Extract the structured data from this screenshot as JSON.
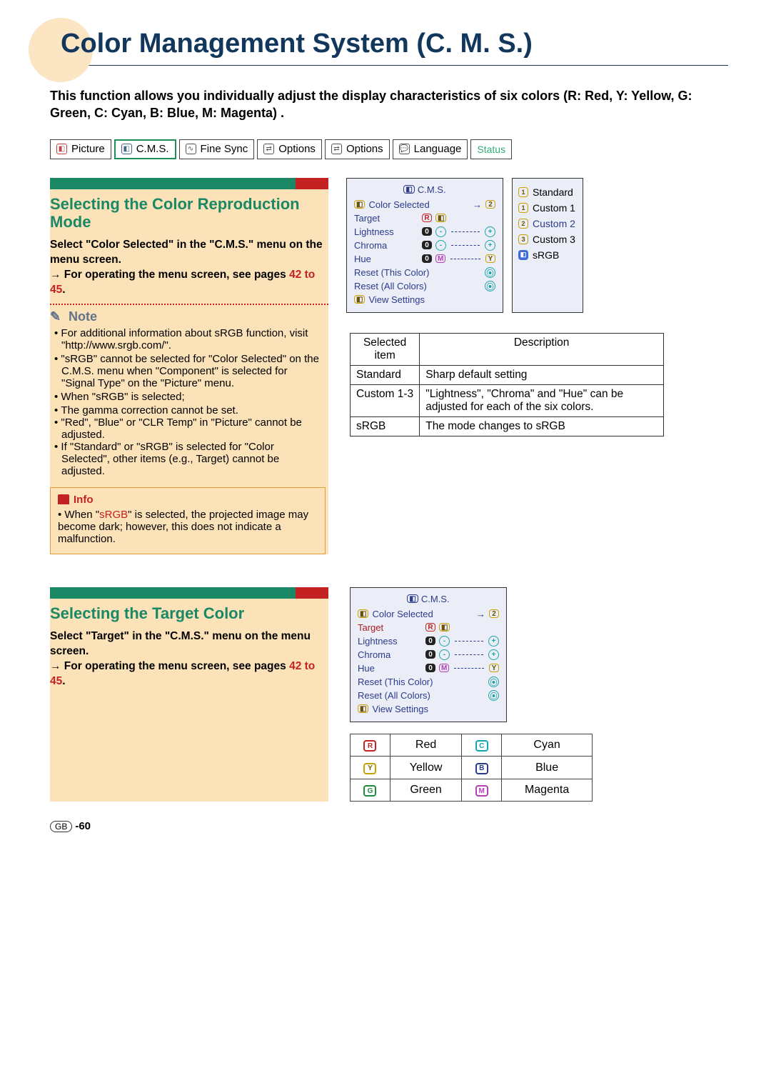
{
  "title": "Color Management System (C. M. S.)",
  "intro": "This function allows you individually adjust the display characteristics of six colors (R: Red, Y: Yellow, G: Green, C: Cyan, B: Blue, M: Magenta) .",
  "menubar": {
    "items": [
      "Picture",
      "C.M.S.",
      "Fine Sync",
      "Options",
      "Options",
      "Language",
      "Status"
    ],
    "active_index": 1
  },
  "section1": {
    "title": "Selecting the Color Reproduction Mode",
    "instr1": "Select \"Color Selected\" in the \"C.M.S.\" menu on the menu screen.",
    "instr2_lead": "→ For operating the menu screen, see pages",
    "pages": "42 to 45",
    "period": ".",
    "note_label": "Note",
    "notes": [
      "For additional information about sRGB function, visit \"http://www.srgb.com/\".",
      "\"sRGB\" cannot be selected for \"Color Selected\" on the C.M.S. menu when \"Component\" is selected for \"Signal Type\" on the \"Picture\" menu.",
      "When \"sRGB\" is selected;",
      "If \"Standard\" or \"sRGB\" is selected for \"Color Selected\", other items (e.g., Target) cannot be adjusted."
    ],
    "sub_notes": [
      "The gamma correction cannot be set.",
      "\"Red\", \"Blue\" or \"CLR Temp\" in \"Picture\" cannot be adjusted."
    ],
    "info_label": "Info",
    "info_text_pre": "When \"",
    "info_text_srgb": "sRGB",
    "info_text_post": "\" is selected, the projected image may become dark; however, this does not indicate a malfunction."
  },
  "osd1": {
    "title": "C.M.S.",
    "rows": {
      "color_selected": "Color Selected",
      "target": "Target",
      "lightness": "Lightness",
      "chroma": "Chroma",
      "hue": "Hue",
      "reset_this": "Reset (This Color)",
      "reset_all": "Reset (All Colors)",
      "view": "View Settings"
    },
    "zero": "0",
    "popup": [
      "Standard",
      "Custom 1",
      "Custom 2",
      "Custom 3",
      "sRGB"
    ]
  },
  "desc_table": {
    "headers": [
      "Selected item",
      "Description"
    ],
    "rows": [
      [
        "Standard",
        "Sharp default setting"
      ],
      [
        "Custom 1-3",
        "\"Lightness\", \"Chroma\" and \"Hue\" can be adjusted for each of the six colors."
      ],
      [
        "sRGB",
        "The mode changes to sRGB"
      ]
    ]
  },
  "section2": {
    "title": "Selecting the Target Color",
    "instr1": "Select \"Target\" in the \"C.M.S.\" menu on the menu screen.",
    "instr2_lead": "→ For operating the menu screen, see pages",
    "pages": "42 to 45",
    "period": "."
  },
  "osd2": {
    "title": "C.M.S.",
    "target_label": "Target"
  },
  "color_table": {
    "rows": [
      [
        "R",
        "Red",
        "C",
        "Cyan"
      ],
      [
        "Y",
        "Yellow",
        "B",
        "Blue"
      ],
      [
        "G",
        "Green",
        "M",
        "Magenta"
      ]
    ]
  },
  "footer": {
    "gb": "GB",
    "pg": "-60"
  }
}
